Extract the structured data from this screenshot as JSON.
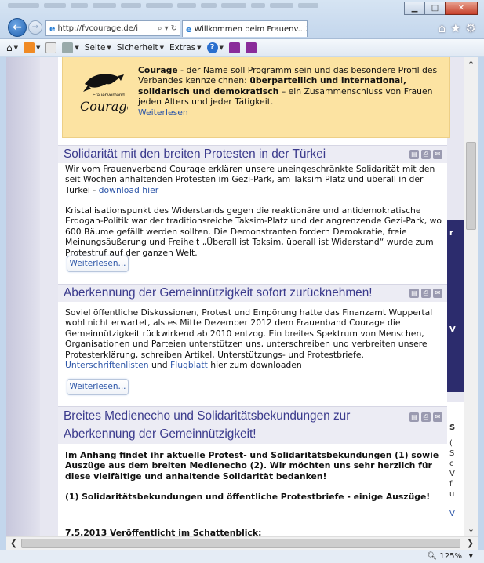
{
  "browser": {
    "address_url": "http://fvcourage.de/i",
    "tab_title": "Willkommen beim Frauenv...",
    "zoom": "125%"
  },
  "cmdbar": {
    "page_label": "Seite",
    "safety_label": "Sicherheit",
    "extras_label": "Extras"
  },
  "intro": {
    "logo_small": "Frauenverband",
    "logo_text": "Courage",
    "brand": "Courage",
    "text1": " - der Name soll Programm sein und das besondere Profil des Verbandes kennzeichnen: ",
    "bold1": "überparteilich und international, solidarisch und demokratisch",
    "text2": " – ein Zusammenschluss von Frauen jeden Alters und jeder Tätigkeit.",
    "more": "Weiterlesen"
  },
  "articles": [
    {
      "title": "Solidarität mit den breiten Protesten in der Türkei",
      "p1": "Wir vom Frauenverband Courage erklären unsere uneingeschränkte Solidarität mit den seit Wochen anhaltenden Protesten im Gezi-Park, am Taksim Platz und überall in der Türkei - ",
      "p1_link": "download hier",
      "p2": "Kristallisationspunkt des Widerstands gegen die reaktionäre und antidemokratische Erdogan-Politik war der traditionsreiche Taksim-Platz und der angrenzende Gezi-Park, wo 600 Bäume gefällt werden sollten. Die Demonstranten fordern Demokratie, freie Meinungsäußerung und Freiheit „Überall ist Taksim, überall ist Widerstand“ wurde zum Protestruf auf der ganzen Welt.",
      "more": "Weiterlesen..."
    },
    {
      "title": "Aberkennung der Gemeinnützigkeit sofort zurücknehmen!",
      "p1": "Soviel öffentliche Diskussionen, Protest und Empörung hatte das Finanzamt Wuppertal wohl nicht erwartet, als es Mitte Dezember 2012 dem Frauenband Courage die Gemeinnützigkeit rückwirkend ab 2010 entzog. Ein breites Spektrum von Menschen, Organisationen und Parteien unterstützen uns, unterschreiben und verbreiten unsere Protesterklärung, schreiben Artikel, Unterstützungs- und Protestbriefe. ",
      "link1": "Unterschriftenlisten",
      "mid": " und ",
      "link2": "Flugblatt",
      "tail": " hier zum downloaden",
      "more": "Weiterlesen..."
    },
    {
      "title_line1": "Breites Medienecho und Solidaritätsbekundungen zur",
      "title_line2": "Aberkennung der Gemeinnützigkeit!",
      "p1": "Im Anhang findet ihr aktuelle Protest- und Solidaritätsbekundungen (1) sowie Auszüge aus dem breiten Medienecho (2). Wir möchten uns sehr herzlich für diese vielfältige und anhaltende Solidarität bedanken!",
      "p2": "(1) Solidaritätsbekundungen und öffentliche Protestbriefe - einige Auszüge!",
      "p3": "7.5.2013 Veröffentlicht im Schattenblick:"
    }
  ],
  "right_column": {
    "letters_blue": [
      "r",
      "V"
    ],
    "letters_white": [
      "S",
      "(",
      "S",
      "c",
      "V",
      "f",
      "u",
      "V"
    ]
  },
  "colors": {
    "intro_bg": "#fce3a2",
    "title_color": "#3a3a8c",
    "link_color": "#2d56a8",
    "head_bg": "#ececf4"
  }
}
